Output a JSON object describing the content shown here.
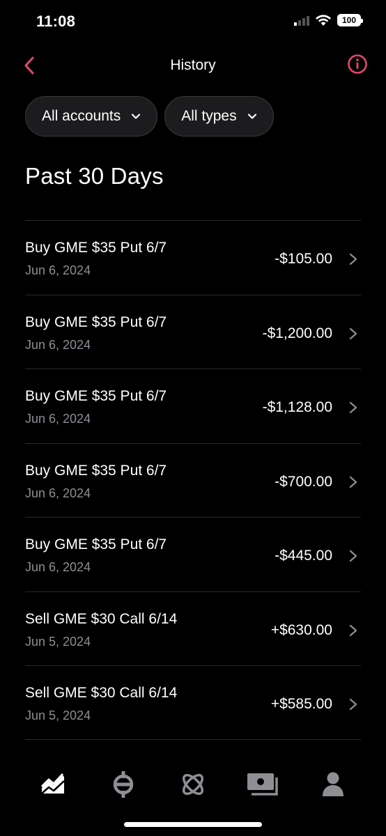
{
  "status_bar": {
    "time": "11:08",
    "battery": "100"
  },
  "header": {
    "title": "History",
    "back_icon": "chevron-left-icon",
    "info_icon": "info-icon"
  },
  "filters": [
    {
      "label": "All accounts"
    },
    {
      "label": "All types"
    }
  ],
  "section_title": "Past 30 Days",
  "transactions": [
    {
      "title": "Buy GME $35 Put 6/7",
      "date": "Jun 6, 2024",
      "amount": "-$105.00"
    },
    {
      "title": "Buy GME $35 Put 6/7",
      "date": "Jun 6, 2024",
      "amount": "-$1,200.00"
    },
    {
      "title": "Buy GME $35 Put 6/7",
      "date": "Jun 6, 2024",
      "amount": "-$1,128.00"
    },
    {
      "title": "Buy GME $35 Put 6/7",
      "date": "Jun 6, 2024",
      "amount": "-$700.00"
    },
    {
      "title": "Buy GME $35 Put 6/7",
      "date": "Jun 6, 2024",
      "amount": "-$445.00"
    },
    {
      "title": "Sell GME $30 Call 6/14",
      "date": "Jun 5, 2024",
      "amount": "+$630.00"
    },
    {
      "title": "Sell GME $30 Call 6/14",
      "date": "Jun 5, 2024",
      "amount": "+$585.00"
    }
  ],
  "tab_bar": [
    {
      "icon": "investing-chart-icon",
      "active": true
    },
    {
      "icon": "crypto-icon",
      "active": false
    },
    {
      "icon": "network-icon",
      "active": false
    },
    {
      "icon": "cash-icon",
      "active": false
    },
    {
      "icon": "account-icon",
      "active": false
    }
  ],
  "colors": {
    "accent": "#e8456f",
    "background": "#000000",
    "secondary_text": "#8e8e93",
    "pill_bg": "#1c1c1e"
  }
}
